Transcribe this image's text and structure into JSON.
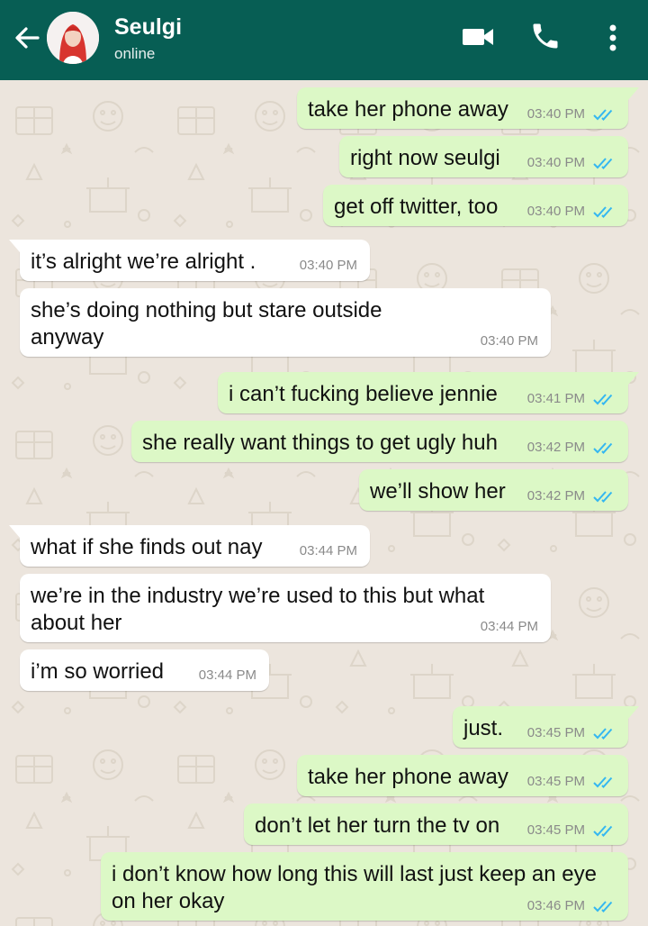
{
  "header": {
    "contact_name": "Seulgi",
    "status": "online",
    "bg_color": "#075e54"
  },
  "icons": {
    "back": "arrow-left-icon",
    "video": "video-camera-icon",
    "call": "phone-icon",
    "menu": "more-vert-icon",
    "read_receipt": "double-check-icon"
  },
  "colors": {
    "outgoing_bubble": "#dcf8c6",
    "incoming_bubble": "#ffffff",
    "read_ticks": "#34b7f1",
    "wallpaper": "#ece5dd"
  },
  "messages": [
    {
      "dir": "out",
      "text": "take her phone away",
      "time": "03:40 PM",
      "read": true
    },
    {
      "dir": "out",
      "text": "right now seulgi",
      "time": "03:40 PM",
      "read": true
    },
    {
      "dir": "out",
      "text": "get off twitter, too",
      "time": "03:40 PM",
      "read": true
    },
    {
      "dir": "in",
      "text": "it’s alright we’re alright .",
      "time": "03:40 PM"
    },
    {
      "dir": "in",
      "text": "she’s doing nothing but stare outside anyway",
      "time": "03:40 PM"
    },
    {
      "dir": "out",
      "text": "i can’t fucking believe jennie",
      "time": "03:41 PM",
      "read": true
    },
    {
      "dir": "out",
      "text": "she really want things to get ugly huh",
      "time": "03:42 PM",
      "read": true
    },
    {
      "dir": "out",
      "text": "we’ll show her",
      "time": "03:42 PM",
      "read": true
    },
    {
      "dir": "in",
      "text": "what if she finds out nay",
      "time": "03:44 PM"
    },
    {
      "dir": "in",
      "text": "we’re in the industry we’re used to this but what about her",
      "time": "03:44 PM"
    },
    {
      "dir": "in",
      "text": "i’m so worried",
      "time": "03:44 PM"
    },
    {
      "dir": "out",
      "text": "just.",
      "time": "03:45 PM",
      "read": true
    },
    {
      "dir": "out",
      "text": "take her phone away",
      "time": "03:45 PM",
      "read": true
    },
    {
      "dir": "out",
      "text": "don’t let her turn the tv on",
      "time": "03:45 PM",
      "read": true
    },
    {
      "dir": "out",
      "text": "i don’t know how long this will last  just keep an eye on her okay",
      "time": "03:46 PM",
      "read": true
    }
  ]
}
